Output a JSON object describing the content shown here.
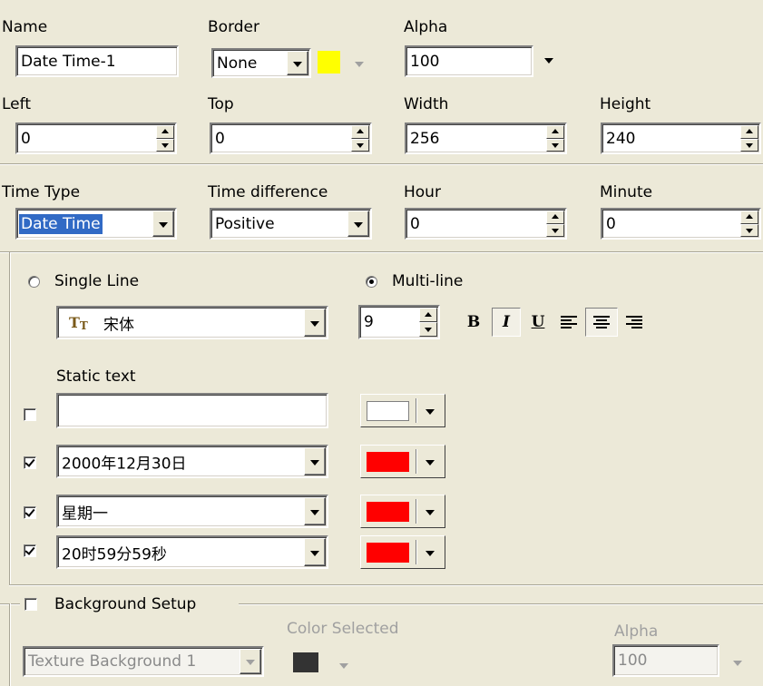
{
  "row1": {
    "name_label": "Name",
    "name_value": "Date Time-1",
    "border_label": "Border",
    "border_value": "None",
    "border_color": "#ffff00",
    "alpha_label": "Alpha",
    "alpha_value": "100"
  },
  "row2": {
    "left_label": "Left",
    "left_value": "0",
    "top_label": "Top",
    "top_value": "0",
    "width_label": "Width",
    "width_value": "256",
    "height_label": "Height",
    "height_value": "240"
  },
  "row3": {
    "time_type_label": "Time Type",
    "time_type_value": "Date Time",
    "time_diff_label": "Time difference",
    "time_diff_value": "Positive",
    "hour_label": "Hour",
    "hour_value": "0",
    "minute_label": "Minute",
    "minute_value": "0"
  },
  "display": {
    "single_line_label": "Single Line",
    "multi_line_label": "Multi-line",
    "font_name": "宋体",
    "font_size": "9",
    "bold": "B",
    "italic": "I",
    "underline": "U"
  },
  "static_text_label": "Static text",
  "lines": [
    {
      "checked": false,
      "value": "",
      "color": "#ffffff"
    },
    {
      "checked": true,
      "value": "2000年12月30日",
      "color": "#ff0000"
    },
    {
      "checked": true,
      "value": "星期一",
      "color": "#ff0000"
    },
    {
      "checked": true,
      "value": "20时59分59秒",
      "color": "#ff0000"
    }
  ],
  "background": {
    "label": "Background Setup",
    "color_selected_label": "Color Selected",
    "alpha_label": "Alpha",
    "texture_value": "Texture Background 1",
    "color": "#333333",
    "alpha_value": "100"
  }
}
